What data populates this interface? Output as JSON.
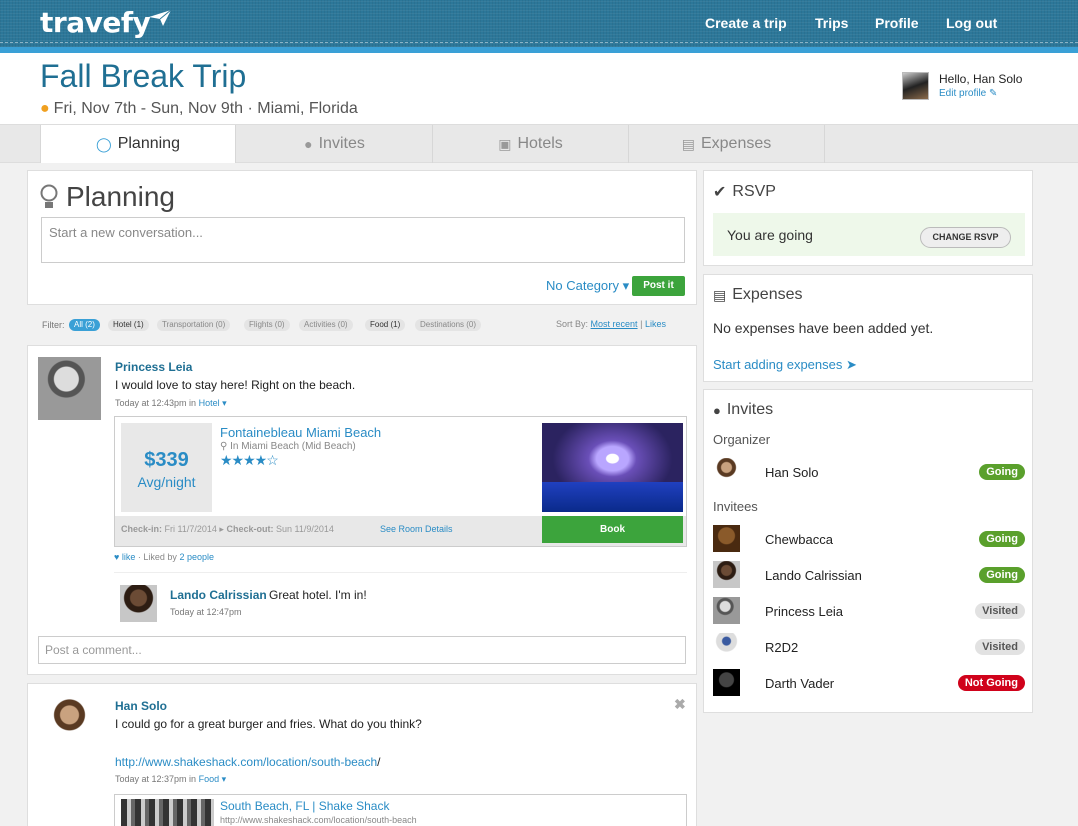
{
  "header": {
    "logo": "travefy",
    "nav": [
      "Create a trip",
      "Trips",
      "Profile",
      "Log out"
    ]
  },
  "trip": {
    "title": "Fall Break Trip",
    "meta": "Fri, Nov 7th - Sun, Nov 9th · Miami, Florida"
  },
  "user": {
    "greeting": "Hello, Han Solo",
    "edit_profile": "Edit profile"
  },
  "tabs": [
    {
      "label": "Planning",
      "icon": "lightbulb-icon",
      "active": true
    },
    {
      "label": "Invites",
      "icon": "user-icon"
    },
    {
      "label": "Hotels",
      "icon": "briefcase-icon"
    },
    {
      "label": "Expenses",
      "icon": "money-icon"
    }
  ],
  "planning": {
    "title": "Planning",
    "conversation_placeholder": "Start a new conversation...",
    "category": "No Category",
    "post_button": "Post it"
  },
  "filters": {
    "label": "Filter:",
    "chips": [
      "All (2)",
      "Hotel (1)",
      "Transportation (0)",
      "Flights (0)",
      "Activities (0)",
      "Food (1)",
      "Destinations (0)"
    ],
    "sort_label": "Sort By:",
    "sort_recent": "Most recent",
    "sort_separator": "|",
    "sort_likes": "Likes"
  },
  "post1": {
    "author": "Princess Leia",
    "text": "I would love to stay here! Right on the beach.",
    "time": "Today at 12:43pm in",
    "category": "Hotel",
    "hotel": {
      "price": "$339",
      "price_unit": "Avg/night",
      "name": "Fontainebleau Miami Beach",
      "location": "In Miami Beach (Mid Beach)",
      "rating": 4.5,
      "checkin_label": "Check-in:",
      "checkin": "Fri 11/7/2014",
      "checkout_label": "Check-out:",
      "checkout": "Sun 11/9/2014",
      "room_details": "See Room Details",
      "book": "Book"
    },
    "like": "like",
    "liked_by": "· Liked by",
    "liked_count": "2 people",
    "comment": {
      "author": "Lando Calrissian",
      "text": "Great hotel. I'm in!",
      "time": "Today at 12:47pm"
    },
    "comment_placeholder": "Post a comment..."
  },
  "post2": {
    "author": "Han Solo",
    "text": "I could go for a great burger and fries. What do you think?",
    "link": "http://www.shakeshack.com/location/south-beach",
    "link_suffix": "/",
    "time": "Today at 12:37pm in",
    "category": "Food",
    "preview_title": "South Beach, FL | Shake Shack",
    "preview_url": "http://www.shakeshack.com/location/south-beach"
  },
  "rsvp": {
    "title": "RSVP",
    "status": "You are going",
    "change": "CHANGE RSVP"
  },
  "expenses": {
    "title": "Expenses",
    "empty": "No expenses have been added yet.",
    "start": "Start adding expenses"
  },
  "invites": {
    "title": "Invites",
    "organizer_label": "Organizer",
    "invitees_label": "Invitees",
    "organizer": {
      "name": "Han Solo",
      "status": "Going"
    },
    "invitees": [
      {
        "name": "Chewbacca",
        "status": "Going"
      },
      {
        "name": "Lando Calrissian",
        "status": "Going"
      },
      {
        "name": "Princess Leia",
        "status": "Visited"
      },
      {
        "name": "R2D2",
        "status": "Visited"
      },
      {
        "name": "Darth Vader",
        "status": "Not Going"
      }
    ]
  },
  "colors": {
    "header": "#2c7799",
    "accent": "#3aa0d6",
    "going": "#5aa02c",
    "not_going": "#d0021b"
  }
}
